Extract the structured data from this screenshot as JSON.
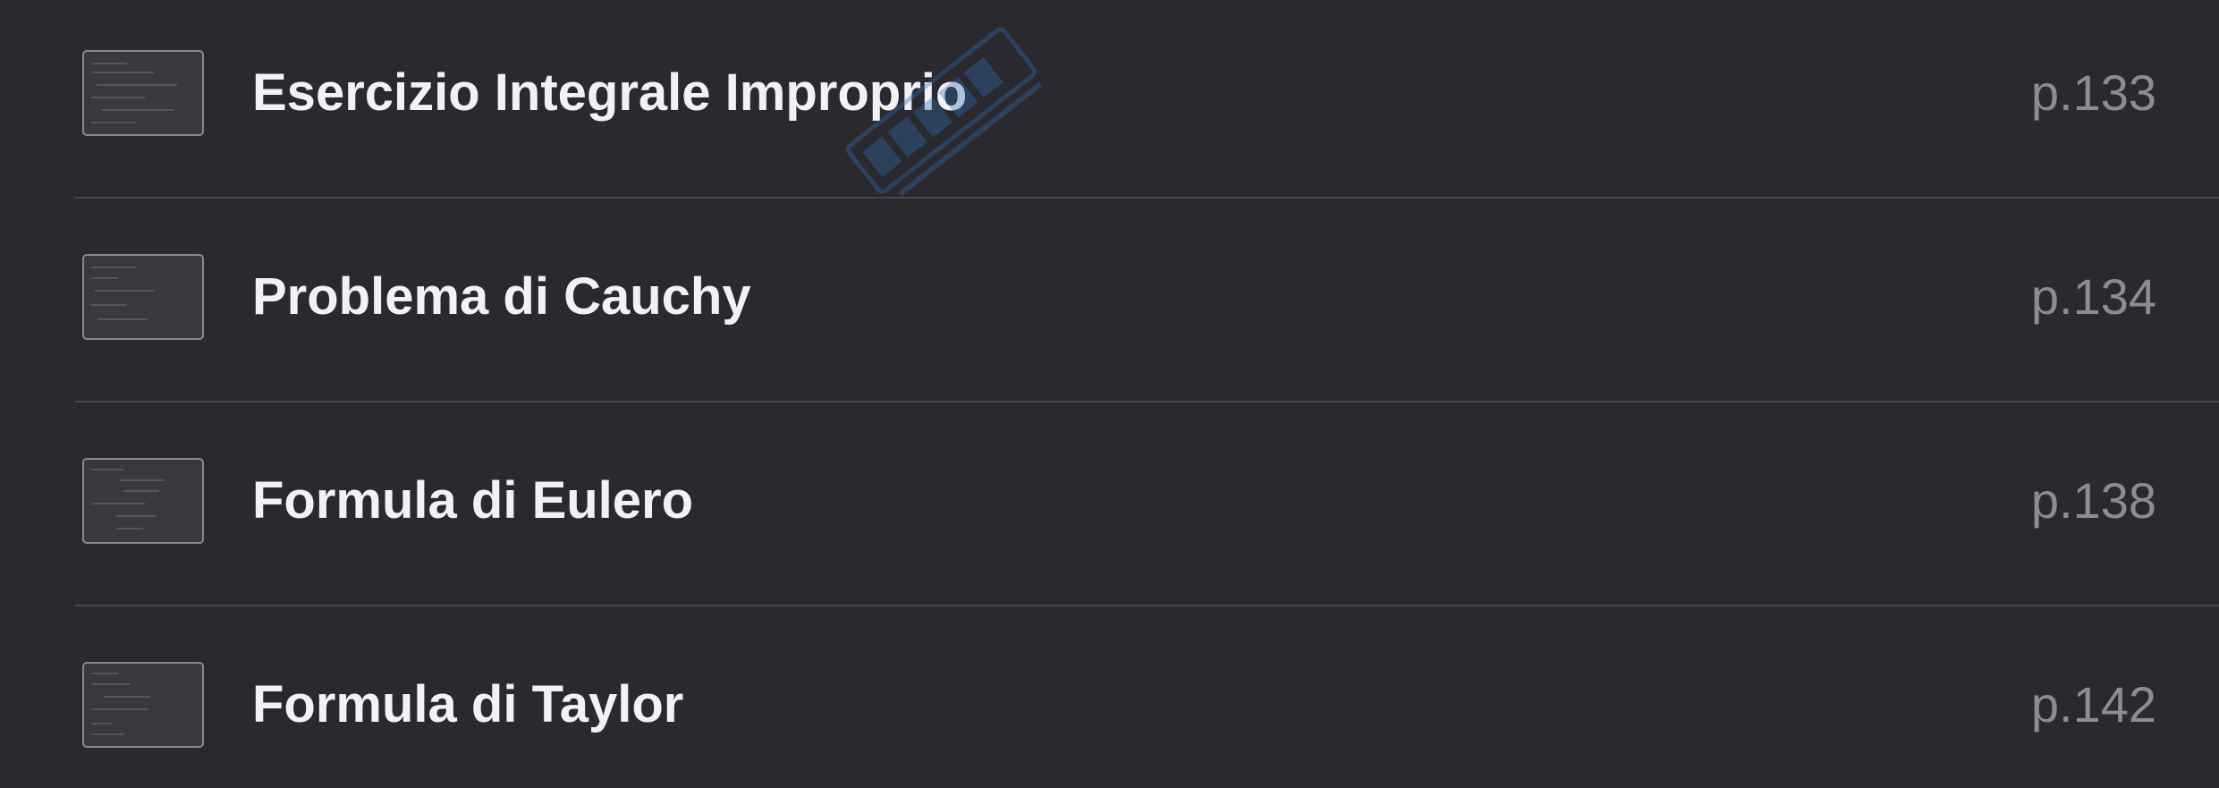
{
  "contents": {
    "items": [
      {
        "title": "Esercizio Integrale Improprio",
        "page": "p.133"
      },
      {
        "title": "Problema di Cauchy",
        "page": "p.134"
      },
      {
        "title": "Formula di Eulero",
        "page": "p.138"
      },
      {
        "title": "Formula di Taylor",
        "page": "p.142"
      }
    ]
  },
  "colors": {
    "background": "#2a292e",
    "title_text": "#f2f2f4",
    "page_text": "#8d8c93",
    "separator": "#46454b",
    "watermark": "#2f6fb4"
  },
  "icons": {
    "thumbnail": "page-thumbnail-icon"
  }
}
